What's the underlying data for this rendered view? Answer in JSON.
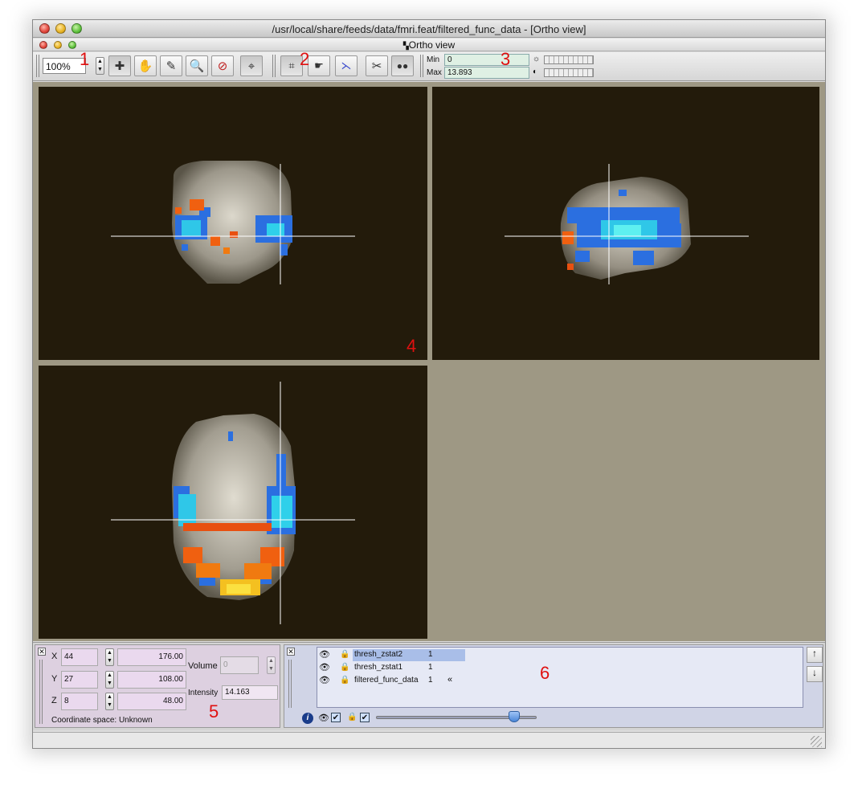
{
  "window": {
    "title": "/usr/local/share/feeds/data/fmri.feat/filtered_func_data - [Ortho view]"
  },
  "panel_title": "Ortho view",
  "annotations": {
    "n1": "1",
    "n2": "2",
    "n3": "3",
    "n4": "4",
    "n5": "5",
    "n6": "6"
  },
  "toolbar": {
    "zoom_value": "100%",
    "tools": [
      "cross-cursor-icon",
      "hand-icon",
      "pencil-icon",
      "magnifier-icon",
      "magnifier-remove-icon",
      "target-icon"
    ],
    "tools2": [
      "crop-icon",
      "hand-point-icon",
      "axes-icon",
      "scissors-icon",
      "binoculars-icon"
    ],
    "min_label": "Min",
    "min_value": "0",
    "max_label": "Max",
    "max_value": "13.893"
  },
  "location": {
    "x_label": "X",
    "x_vox": "44",
    "x_mm": "176.00",
    "y_label": "Y",
    "y_vox": "27",
    "y_mm": "108.00",
    "z_label": "Z",
    "z_vox": "8",
    "z_mm": "48.00",
    "volume_label": "Volume",
    "volume_value": "0",
    "intensity_label": "Intensity",
    "intensity_value": "14.163",
    "coord_space": "Coordinate space: Unknown"
  },
  "layers": {
    "items": [
      {
        "name": "thresh_zstat2",
        "volume": "1",
        "selected": true
      },
      {
        "name": "thresh_zstat1",
        "volume": "1",
        "selected": false
      },
      {
        "name": "filtered_func_data",
        "volume": "1",
        "selected": false
      }
    ],
    "opacity": 0.86
  },
  "colors": {
    "canvas_bg": "#231b0b",
    "empty_bg": "#9e9884",
    "selected_row": "#a9bee8",
    "annotation": "#e01010"
  }
}
